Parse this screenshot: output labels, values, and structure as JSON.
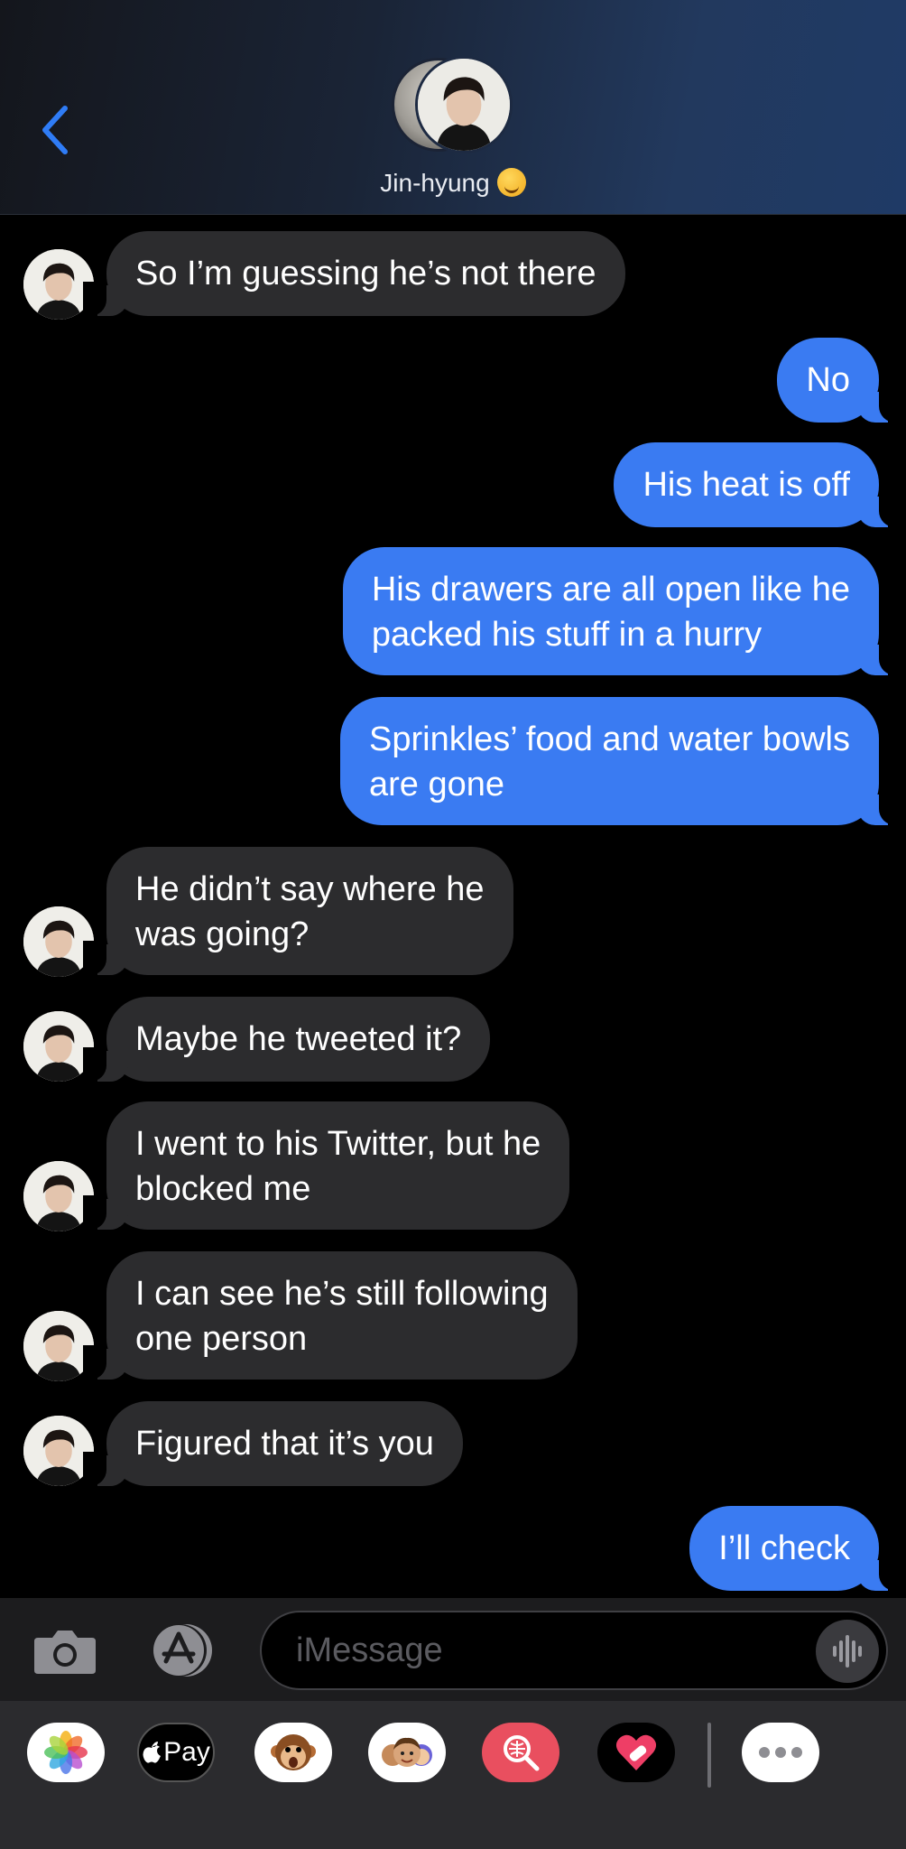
{
  "header": {
    "contact_name": "Jin-hyung",
    "emoji_icon": "smiling-face-emoji",
    "back_icon": "chevron-left-icon",
    "accent_color": "#2f7cf6"
  },
  "messages": [
    {
      "side": "in",
      "text": "So I’m guessing he’s not there"
    },
    {
      "side": "out",
      "text": "No"
    },
    {
      "side": "out",
      "text": "His heat is off"
    },
    {
      "side": "out",
      "text": "His drawers are all open like he\npacked his stuff in a hurry"
    },
    {
      "side": "out",
      "text": "Sprinkles’ food and water bowls\nare gone"
    },
    {
      "side": "in",
      "text": "He didn’t say where he\nwas going?"
    },
    {
      "side": "in",
      "text": "Maybe he tweeted it?"
    },
    {
      "side": "in",
      "text": "I went to his Twitter, but he\nblocked me"
    },
    {
      "side": "in",
      "text": "I can see he’s still following\none person"
    },
    {
      "side": "in",
      "text": "Figured that it’s you"
    },
    {
      "side": "out",
      "text": "I’ll check"
    }
  ],
  "input": {
    "placeholder": "iMessage",
    "value": ""
  },
  "drawer": {
    "apps": [
      "photos-icon",
      "apple-pay-icon",
      "animoji-icon",
      "memoji-icon",
      "image-search-icon",
      "digital-touch-icon",
      "more-icon"
    ],
    "apple_pay_label": "Pay"
  },
  "colors": {
    "incoming_bubble": "#2c2c2e",
    "outgoing_bubble": "#3a7bf2",
    "background": "#000000"
  }
}
